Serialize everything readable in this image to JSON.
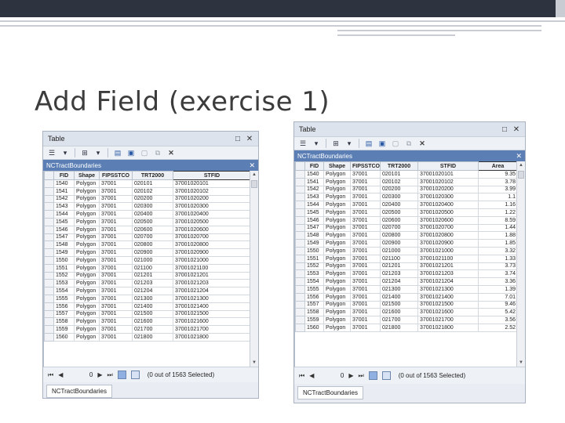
{
  "slide": {
    "title": "Add Field (exercise 1)"
  },
  "windows": {
    "left": {
      "title": "Table",
      "tab_name": "NCTractBoundaries",
      "columns": [
        "FID",
        "Shape",
        "FIPSSTCO",
        "TRT2000",
        "STFID"
      ],
      "selected_column": "STFID",
      "rows": [
        [
          "1540",
          "Polygon",
          "37001",
          "020101",
          "37001020101"
        ],
        [
          "1541",
          "Polygon",
          "37001",
          "020102",
          "37001020102"
        ],
        [
          "1542",
          "Polygon",
          "37001",
          "020200",
          "37001020200"
        ],
        [
          "1543",
          "Polygon",
          "37001",
          "020300",
          "37001020300"
        ],
        [
          "1544",
          "Polygon",
          "37001",
          "020400",
          "37001020400"
        ],
        [
          "1545",
          "Polygon",
          "37001",
          "020500",
          "37001020500"
        ],
        [
          "1546",
          "Polygon",
          "37001",
          "020600",
          "37001020600"
        ],
        [
          "1547",
          "Polygon",
          "37001",
          "020700",
          "37001020700"
        ],
        [
          "1548",
          "Polygon",
          "37001",
          "020800",
          "37001020800"
        ],
        [
          "1549",
          "Polygon",
          "37001",
          "020900",
          "37001020900"
        ],
        [
          "1550",
          "Polygon",
          "37001",
          "021000",
          "37001021000"
        ],
        [
          "1551",
          "Polygon",
          "37001",
          "021100",
          "37001021100"
        ],
        [
          "1552",
          "Polygon",
          "37001",
          "021201",
          "37001021201"
        ],
        [
          "1553",
          "Polygon",
          "37001",
          "021203",
          "37001021203"
        ],
        [
          "1554",
          "Polygon",
          "37001",
          "021204",
          "37001021204"
        ],
        [
          "1555",
          "Polygon",
          "37001",
          "021300",
          "37001021300"
        ],
        [
          "1556",
          "Polygon",
          "37001",
          "021400",
          "37001021400"
        ],
        [
          "1557",
          "Polygon",
          "37001",
          "021500",
          "37001021500"
        ],
        [
          "1558",
          "Polygon",
          "37001",
          "021600",
          "37001021600"
        ],
        [
          "1559",
          "Polygon",
          "37001",
          "021700",
          "37001021700"
        ],
        [
          "1560",
          "Polygon",
          "37001",
          "021800",
          "37001021800"
        ]
      ],
      "nav": {
        "record": "0",
        "selection": "(0 out of 1563 Selected)"
      },
      "bottom_tab": "NCTractBoundaries"
    },
    "right": {
      "title": "Table",
      "tab_name": "NCTractBoundaries",
      "columns": [
        "FID",
        "Shape",
        "FIPSSTCO",
        "TRT2000",
        "STFID",
        "Area"
      ],
      "selected_column": "Area",
      "rows": [
        [
          "1540",
          "Polygon",
          "37001",
          "020101",
          "37001020101",
          "9.35"
        ],
        [
          "1541",
          "Polygon",
          "37001",
          "020102",
          "37001020102",
          "3.78"
        ],
        [
          "1542",
          "Polygon",
          "37001",
          "020200",
          "37001020200",
          "3.99"
        ],
        [
          "1543",
          "Polygon",
          "37001",
          "020300",
          "37001020300",
          "1.1"
        ],
        [
          "1544",
          "Polygon",
          "37001",
          "020400",
          "37001020400",
          "1.16"
        ],
        [
          "1545",
          "Polygon",
          "37001",
          "020500",
          "37001020500",
          "1.22"
        ],
        [
          "1546",
          "Polygon",
          "37001",
          "020600",
          "37001020600",
          "8.59"
        ],
        [
          "1547",
          "Polygon",
          "37001",
          "020700",
          "37001020700",
          "1.44"
        ],
        [
          "1548",
          "Polygon",
          "37001",
          "020800",
          "37001020800",
          "1.88"
        ],
        [
          "1549",
          "Polygon",
          "37001",
          "020900",
          "37001020900",
          "1.85"
        ],
        [
          "1550",
          "Polygon",
          "37001",
          "021000",
          "37001021000",
          "3.32"
        ],
        [
          "1551",
          "Polygon",
          "37001",
          "021100",
          "37001021100",
          "1.33"
        ],
        [
          "1552",
          "Polygon",
          "37001",
          "021201",
          "37001021201",
          "3.73"
        ],
        [
          "1553",
          "Polygon",
          "37001",
          "021203",
          "37001021203",
          "3.74"
        ],
        [
          "1554",
          "Polygon",
          "37001",
          "021204",
          "37001021204",
          "3.36"
        ],
        [
          "1555",
          "Polygon",
          "37001",
          "021300",
          "37001021300",
          "1.39"
        ],
        [
          "1556",
          "Polygon",
          "37001",
          "021400",
          "37001021400",
          "7.01"
        ],
        [
          "1557",
          "Polygon",
          "37001",
          "021500",
          "37001021500",
          "9.46"
        ],
        [
          "1558",
          "Polygon",
          "37001",
          "021600",
          "37001021600",
          "5.42"
        ],
        [
          "1559",
          "Polygon",
          "37001",
          "021700",
          "37001021700",
          "3.56"
        ],
        [
          "1560",
          "Polygon",
          "37001",
          "021800",
          "37001021800",
          "2.52"
        ]
      ],
      "nav": {
        "record": "0",
        "selection": "(0 out of 1563 Selected)"
      },
      "bottom_tab": "NCTractBoundaries"
    }
  },
  "icons": {
    "table_options": "table-options-icon",
    "related_tables": "related-tables-icon",
    "select_by_attributes": "select-by-attributes-icon",
    "switch_selection": "switch-selection-icon",
    "clear_selection": "clear-selection-icon",
    "zoom_to_selected": "zoom-to-selected-icon",
    "delete_selected": "delete-selected-icon"
  },
  "colors": {
    "header_bar": "#2e3340",
    "tab_header": "#5b7fb5",
    "window_bg": "#e9edf3"
  }
}
